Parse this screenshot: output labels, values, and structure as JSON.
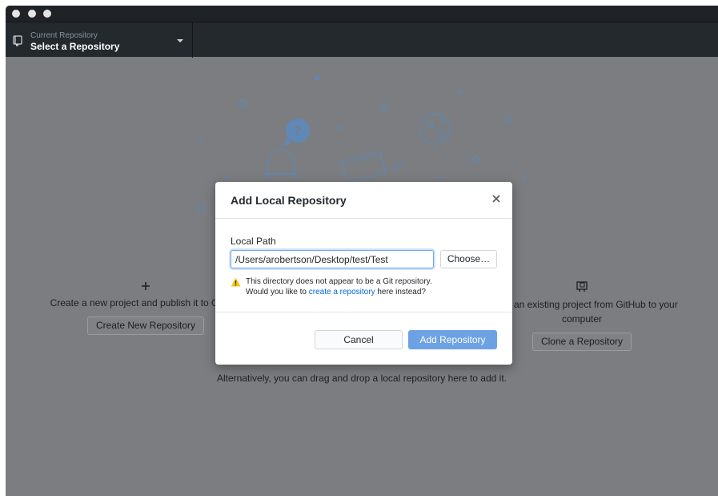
{
  "colors": {
    "toolbar_bg": "#24292e",
    "overlay_bg": "#7b7d80",
    "link": "#0366d6",
    "primary_button": "#6ca2e3",
    "warning": "#f9c513"
  },
  "window": {
    "traffic_lights": [
      "close-icon",
      "minimize-icon",
      "zoom-icon"
    ]
  },
  "toolbar": {
    "repo_caption": "Current Repository",
    "repo_title": "Select a Repository",
    "repo_icon": "repo-icon",
    "dropdown_icon": "triangle-down-icon"
  },
  "blank_slate": {
    "create": {
      "icon": "plus-icon",
      "text": "Create a new project and publish it to GitHub",
      "button": "Create New Repository"
    },
    "clone": {
      "icon": "desktop-download-icon",
      "text_line1": "Clone an existing project from GitHub to your",
      "text_line2": "computer",
      "button": "Clone a Repository"
    },
    "drag_note": "Alternatively, you can drag and drop a local repository here to add it."
  },
  "dialog": {
    "title": "Add Local Repository",
    "close_icon": "x-icon",
    "field_label": "Local Path",
    "path_value": "/Users/arobertson/Desktop/test/Test",
    "choose_label": "Choose…",
    "warning_icon": "alert-icon",
    "warning_line1": "This directory does not appear to be a Git repository.",
    "warning_line2_prefix": "Would you like to ",
    "warning_link": "create a repository",
    "warning_line2_suffix": " here instead?",
    "cancel_label": "Cancel",
    "add_label": "Add Repository"
  }
}
